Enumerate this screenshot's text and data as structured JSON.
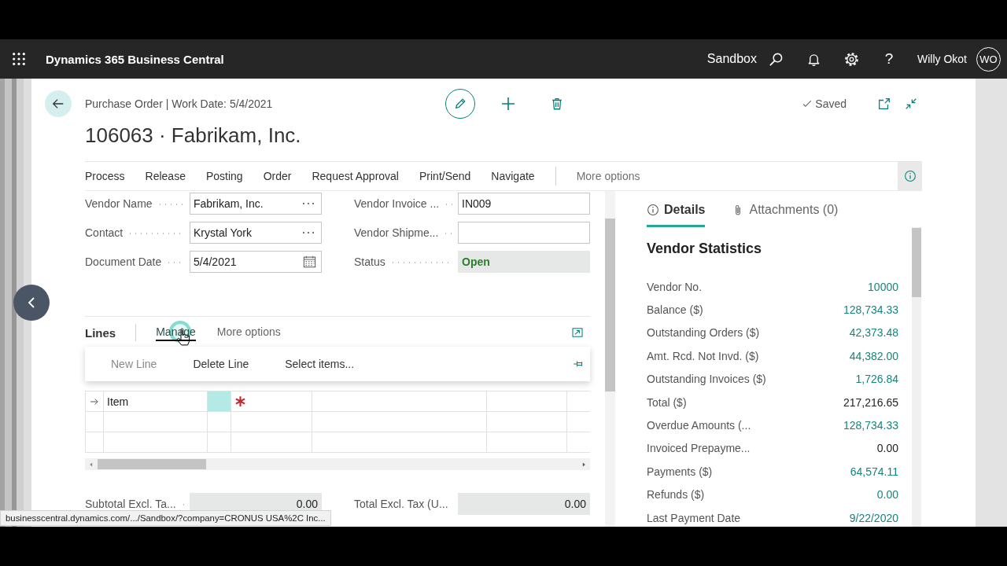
{
  "top_bar": {
    "app_title": "Dynamics 365 Business Central",
    "environment": "Sandbox",
    "help": "?",
    "user_name": "Willy Okot",
    "user_initials": "WO"
  },
  "header": {
    "breadcrumb": "Purchase Order | Work Date: 5/4/2021",
    "title": "106063 · Fabrikam, Inc.",
    "save_status": "Saved"
  },
  "action_bar": {
    "actions": [
      "Process",
      "Release",
      "Posting",
      "Order",
      "Request Approval",
      "Print/Send",
      "Navigate"
    ],
    "overflow": "More options"
  },
  "general": {
    "fields": [
      {
        "label": "Vendor Name",
        "value": "Fabrikam, Inc.",
        "kind": "lookup"
      },
      {
        "label": "Vendor Invoice ...",
        "value": "IN009",
        "kind": "text"
      },
      {
        "label": "Contact",
        "value": "Krystal York",
        "kind": "lookup"
      },
      {
        "label": "Vendor Shipme...",
        "kind": "text"
      },
      {
        "label": "Document Date",
        "value": "5/4/2021",
        "kind": "date"
      },
      {
        "label": "Status",
        "value": "Open",
        "kind": "status"
      }
    ]
  },
  "lines": {
    "title": "Lines",
    "tabs": [
      {
        "label": "Manage",
        "selected": true
      },
      {
        "label": "More options",
        "selected": false
      }
    ],
    "menu": [
      {
        "label": "New Line",
        "disabled": true
      },
      {
        "label": "Delete Line",
        "disabled": false
      },
      {
        "label": "Select items...",
        "disabled": false
      }
    ],
    "rows": [
      {
        "current": true,
        "type": "Item",
        "focused": true,
        "required": true
      },
      {
        "current": false,
        "focused": false,
        "required": false
      },
      {
        "current": false,
        "focused": false,
        "required": false
      }
    ]
  },
  "totals": [
    {
      "label": "Subtotal Excl. Ta...",
      "value": "0.00"
    },
    {
      "label": "Total Excl. Tax (U...",
      "value": "0.00"
    }
  ],
  "factbox": {
    "tabs": [
      {
        "label": "Details",
        "kind": "details",
        "selected": true
      },
      {
        "label": "Attachments (0)",
        "kind": "attachments",
        "selected": false
      }
    ],
    "title": "Vendor Statistics",
    "rows": [
      {
        "label": "Vendor No.",
        "value": "10000",
        "link": true
      },
      {
        "label": "Balance ($)",
        "value": "128,734.33",
        "link": true
      },
      {
        "label": "Outstanding Orders ($)",
        "value": "42,373.48",
        "link": true
      },
      {
        "label": "Amt. Rcd. Not Invd. ($)",
        "value": "44,382.00",
        "link": true
      },
      {
        "label": "Outstanding Invoices ($)",
        "value": "1,726.84",
        "link": true
      },
      {
        "label": "Total ($)",
        "value": "217,216.65",
        "link": false
      },
      {
        "label": "Overdue Amounts (...",
        "value": "128,734.33",
        "link": true
      },
      {
        "label": "Invoiced Prepayme...",
        "value": "0.00",
        "link": false
      },
      {
        "label": "Payments ($)",
        "value": "64,574.11",
        "link": true
      },
      {
        "label": "Refunds ($)",
        "value": "0.00",
        "link": true
      },
      {
        "label": "Last Payment Date",
        "value": "9/22/2020",
        "link": true
      }
    ]
  },
  "status_url": "businesscentral.dynamics.com/.../Sandbox/?company=CRONUS USA%2C Inc..."
}
